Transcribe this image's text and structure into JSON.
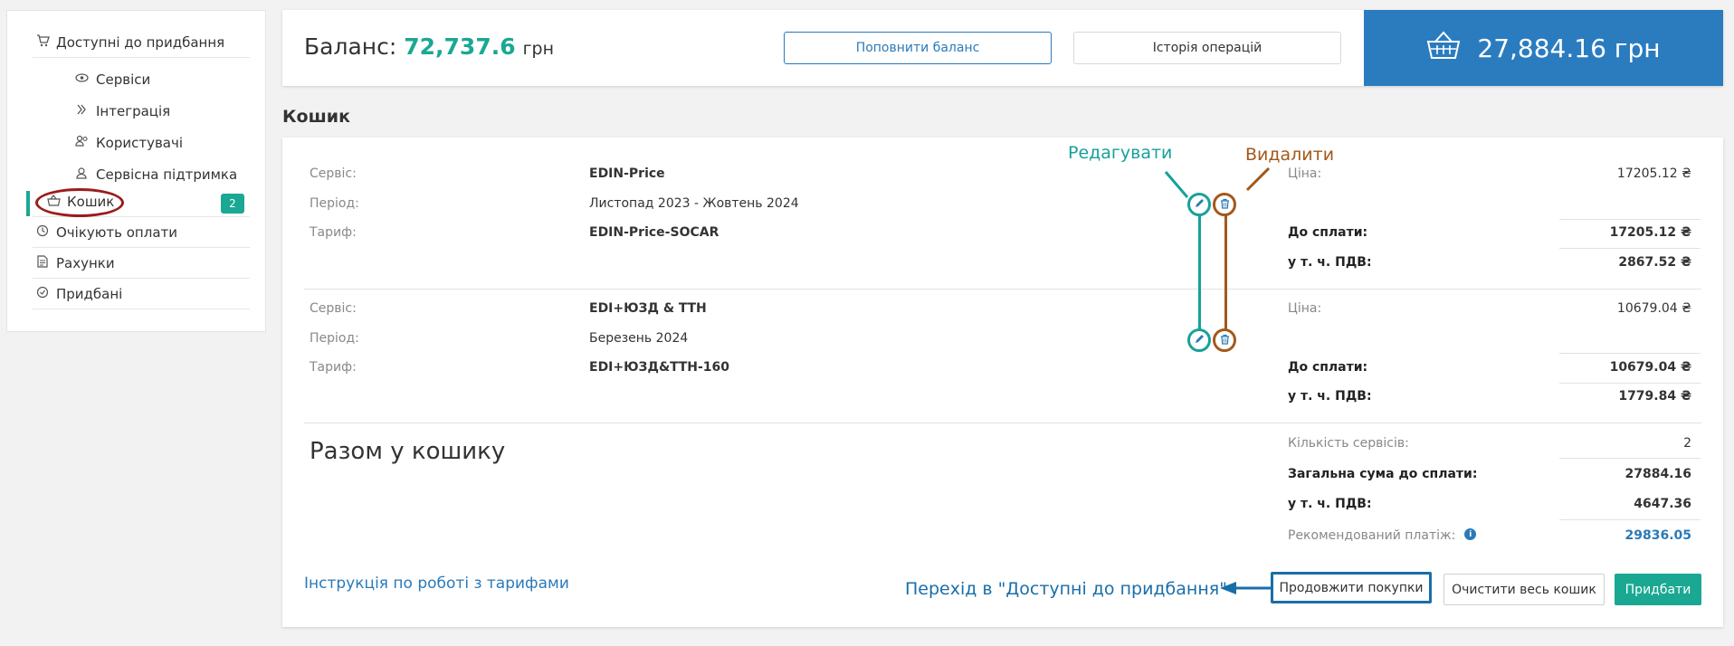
{
  "sidebar": {
    "items": [
      {
        "label": "Доступні до придбання",
        "icon": "cart-icon"
      },
      {
        "label": "Сервіси",
        "icon": "eye-icon"
      },
      {
        "label": "Інтеграція",
        "icon": "integration-icon"
      },
      {
        "label": "Користувачі",
        "icon": "users-icon"
      },
      {
        "label": "Сервісна підтримка",
        "icon": "support-icon"
      },
      {
        "label": "Кошик",
        "icon": "basket-icon",
        "badge": "2"
      },
      {
        "label": "Очікують оплати",
        "icon": "clock-icon"
      },
      {
        "label": "Рахунки",
        "icon": "document-icon"
      },
      {
        "label": "Придбані",
        "icon": "check-circle-icon"
      }
    ]
  },
  "header": {
    "balance_label": "Баланс:",
    "balance_value": "72,737.6",
    "balance_currency": "грн",
    "topup_label": "Поповнити баланс",
    "history_label": "Історія операцій",
    "cart_total": "27,884.16 грн"
  },
  "section_title": "Кошик",
  "labels": {
    "service": "Сервіс:",
    "period": "Період:",
    "tariff": "Тариф:",
    "price": "Ціна:",
    "to_pay": "До сплати:",
    "vat": "у т. ч. ПДВ:"
  },
  "cart_items": [
    {
      "service": "EDIN-Price",
      "period": "Листопад 2023 - Жовтень 2024",
      "tariff": "EDIN-Price-SOCAR",
      "price": "17205.12 ₴",
      "to_pay": "17205.12 ₴",
      "vat": "2867.52 ₴"
    },
    {
      "service": "EDI+ЮЗД & ТТН",
      "period": "Березень 2024",
      "tariff": "EDI+ЮЗД&ТТН-160",
      "price": "10679.04 ₴",
      "to_pay": "10679.04 ₴",
      "vat": "1779.84 ₴"
    }
  ],
  "totals": {
    "title": "Разом у кошику",
    "count_label": "Кількість сервісів:",
    "count_value": "2",
    "sum_label": "Загальна сума до сплати:",
    "sum_value": "27884.16",
    "vat_label": "у т. ч. ПДВ:",
    "vat_value": "4647.36",
    "recommended_label": "Рекомендований платіж:",
    "recommended_value": "29836.05"
  },
  "annotations": {
    "edit": "Редагувати",
    "delete": "Видалити",
    "go_available": "Перехід в \"Доступні до придбання\""
  },
  "footer": {
    "instructions_link": "Інструкція по роботі з тарифами",
    "continue_label": "Продовжити покупки",
    "clear_label": "Очистити весь кошик",
    "buy_label": "Придбати"
  },
  "colors": {
    "accent_teal": "#1aa893",
    "primary_blue": "#2a7cbf",
    "annotation_teal": "#17a19a",
    "annotation_brown": "#a4581a",
    "highlight_red": "#9b1c1c"
  }
}
